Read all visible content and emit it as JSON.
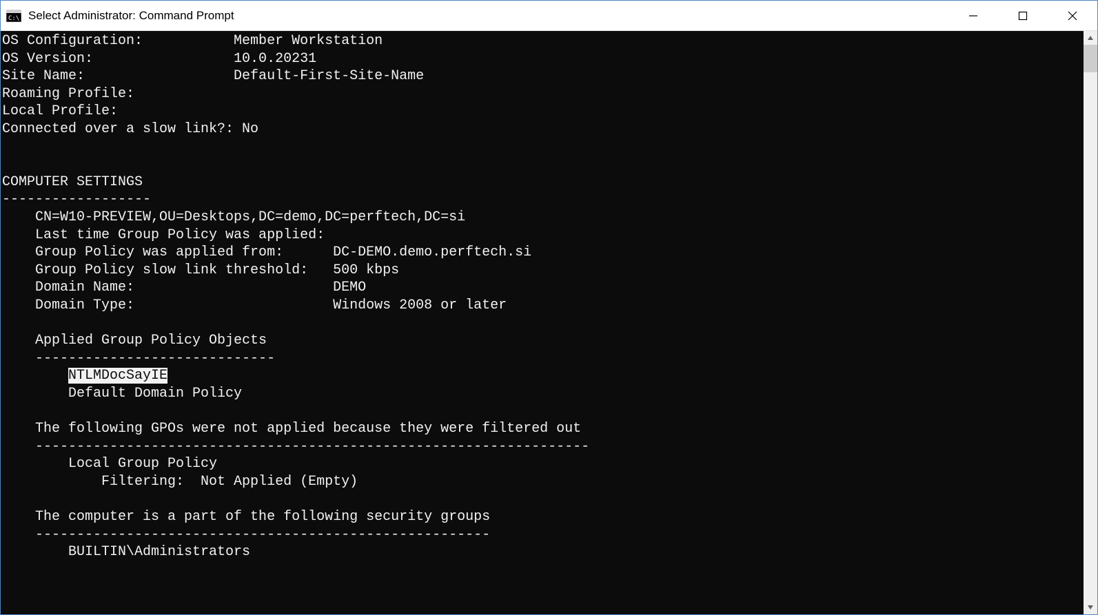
{
  "window": {
    "title": "Select Administrator: Command Prompt"
  },
  "term": {
    "lines": [
      {
        "label": "OS Configuration:",
        "value": "Member Workstation",
        "col": 28,
        "indent": 0
      },
      {
        "label": "OS Version:",
        "value": "10.0.20231",
        "col": 28,
        "indent": 0
      },
      {
        "label": "Site Name:",
        "value": "Default-First-Site-Name",
        "col": 28,
        "indent": 0
      },
      {
        "label": "Roaming Profile:",
        "value": "",
        "col": 28,
        "indent": 0
      },
      {
        "label": "Local Profile:",
        "value": "",
        "col": 28,
        "indent": 0
      },
      {
        "label": "Connected over a slow link?:",
        "value": "No",
        "col": 27,
        "indent": 0
      }
    ],
    "blank1": "",
    "blank2": "",
    "comp_settings_title": "COMPUTER SETTINGS",
    "comp_settings_rule": "------------------",
    "cs": [
      {
        "text": "    CN=W10-PREVIEW,OU=Desktops,DC=demo,DC=perftech,DC=si"
      },
      {
        "text": "    Last time Group Policy was applied:"
      }
    ],
    "cs_kv": [
      {
        "label": "    Group Policy was applied from:",
        "value": "DC-DEMO.demo.perftech.si",
        "col": 40
      },
      {
        "label": "    Group Policy slow link threshold:",
        "value": "500 kbps",
        "col": 40
      },
      {
        "label": "    Domain Name:",
        "value": "DEMO",
        "col": 40
      },
      {
        "label": "    Domain Type:",
        "value": "Windows 2008 or later",
        "col": 40
      }
    ],
    "blank3": "",
    "agpo_title": "    Applied Group Policy Objects",
    "agpo_rule": "    -----------------------------",
    "agpo_items_pre": "        ",
    "agpo_item_sel": "NTLMDocSayIE",
    "agpo_item2": "        Default Domain Policy",
    "blank4": "",
    "filtered_title": "    The following GPOs were not applied because they were filtered out",
    "filtered_rule": "    -------------------------------------------------------------------",
    "filtered_item": "        Local Group Policy",
    "filtered_reason": "            Filtering:  Not Applied (Empty)",
    "blank5": "",
    "secgrp_title": "    The computer is a part of the following security groups",
    "secgrp_rule": "    -------------------------------------------------------",
    "secgrp_item": "        BUILTIN\\Administrators"
  }
}
